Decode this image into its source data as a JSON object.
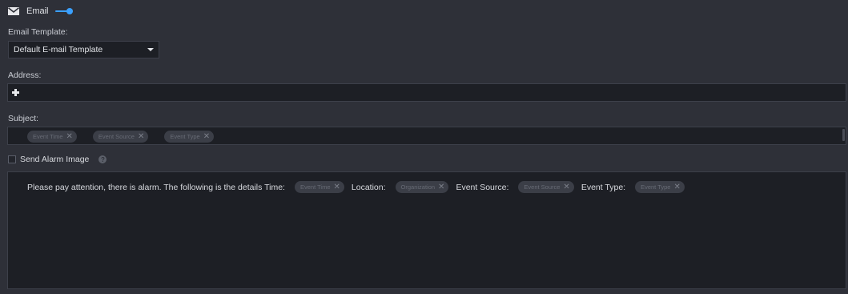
{
  "header": {
    "label": "Email",
    "enabled": true
  },
  "template": {
    "label": "Email Template:",
    "selected": "Default E-mail Template"
  },
  "address": {
    "label": "Address:"
  },
  "subject": {
    "label": "Subject:",
    "tags": [
      "Event Time",
      "Event Source",
      "Event Type"
    ]
  },
  "alarm_image": {
    "label": "Send Alarm Image",
    "checked": false
  },
  "body": {
    "intro": "Please pay attention, there is alarm. The following is the details Time:",
    "time_tag": "Event Time",
    "location_label": "Location:",
    "location_tag": "Organization",
    "source_label": "Event Source:",
    "source_tag": "Event Source",
    "type_label": "Event Type:",
    "type_tag": "Event Type"
  },
  "colors": {
    "accent": "#3aa0ff",
    "background": "#2e3038",
    "field": "#1d1f25"
  }
}
